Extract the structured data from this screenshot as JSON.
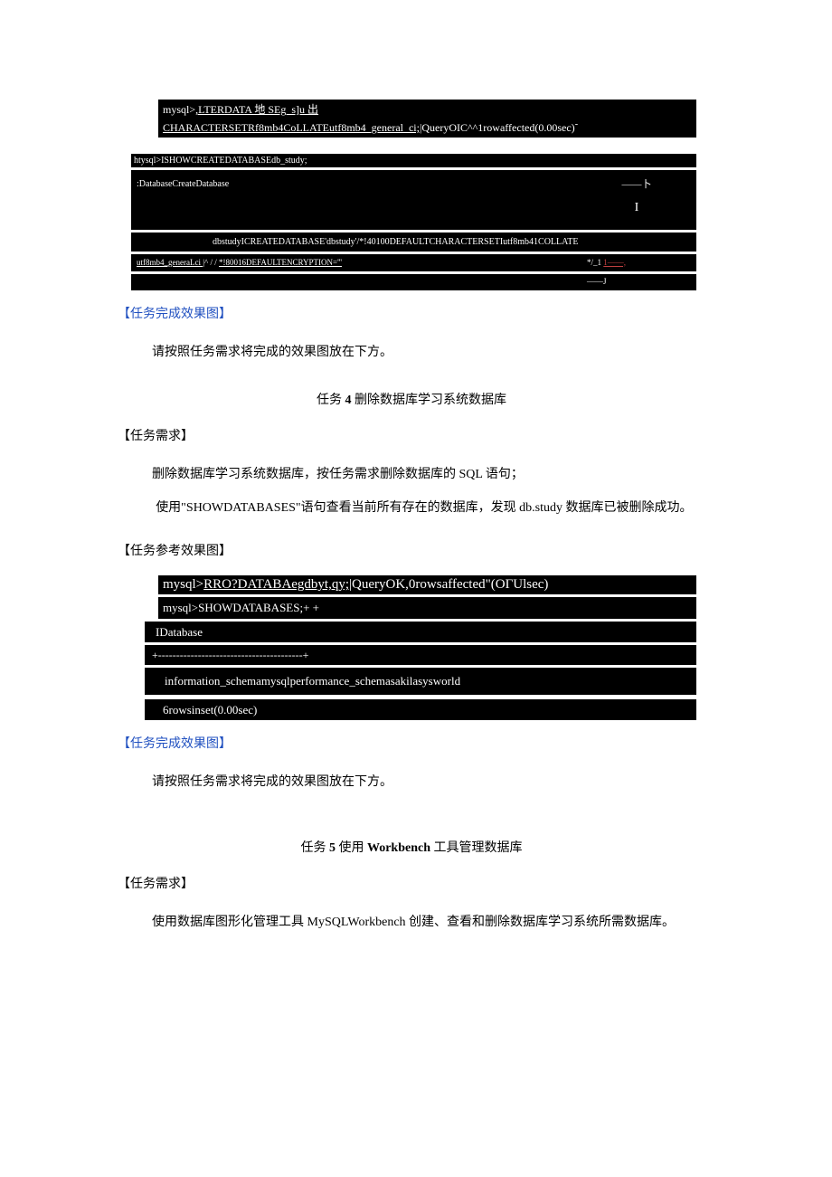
{
  "code1": {
    "line1_prefix": "mysql>",
    "line1_underline": ",LTERDATA 地 SEg_s]u 出",
    "line2_underline": "CHARACTERSETRf8mb4CoLLATEutf8mb4_general_ci;",
    "line2_rest": "|QueryOIC^^1rowaffected(0.00sec)"
  },
  "code2": {
    "line1": "htysql>ISHOWCREATEDATABASEdb_study;",
    "line2_left": ":DatabaseCreateDatabase",
    "line2_divider_top": "——卜",
    "line2_divider_bottom": "I",
    "line3": "dbstudyICREATEDATABASE'dbstudy'/*!40100DEFAULTCHARACTERSETIutf8mb41COLLATE",
    "line4_left_a": "utf8mb4_generaLci ",
    "line4_left_b": "|^ / /",
    "line4_left_c": "*!80016DEFAULTENCRYPTION='''",
    "line4_right_a": "*/_1",
    "line4_right_b_suffix": "1——,",
    "line5_right": "——J"
  },
  "section1": {
    "title": "【任务完成效果图】",
    "para": "请按照任务需求将完成的效果图放在下方。"
  },
  "task4": {
    "heading_prefix": "任务 ",
    "heading_num": "4",
    "heading_suffix": " 删除数据库学习系统数据库",
    "req_title": "【任务需求】",
    "para1": "删除数据库学习系统数据库，按任务需求删除数据库的 SQL 语句；",
    "para2": "使用\"SHOWDATABASES\"语句查看当前所有存在的数据库，发现 db.study 数据库已被删除成功。",
    "ref_title": "【任务参考效果图】"
  },
  "code3": {
    "line1_prefix": "mysql>",
    "line1_underline": "RRO?DATABAegdbyt,qy;",
    "line1_rest": "|QueryOK,0rowsaffected\"(OГUlsec)"
  },
  "code4": {
    "line1": "mysql>SHOWDATABASES;+                                           +",
    "line2": "IDatabase",
    "line3": "+----------------------------------------+",
    "line4": "information_schemamysqlperformance_schemasakilasysworld",
    "line5": "6rowsinset(0.00sec)"
  },
  "section2": {
    "title": "【任务完成效果图】",
    "para": "请按照任务需求将完成的效果图放在下方。"
  },
  "task5": {
    "heading_prefix": "任务 ",
    "heading_num": "5",
    "heading_mid": " 使用 ",
    "heading_bold": "Workbench",
    "heading_suffix": " 工具管理数据库",
    "req_title": "【任务需求】",
    "para1": "使用数据库图形化管理工具 MySQLWorkbench 创建、查看和删除数据库学习系统所需数据库。"
  }
}
